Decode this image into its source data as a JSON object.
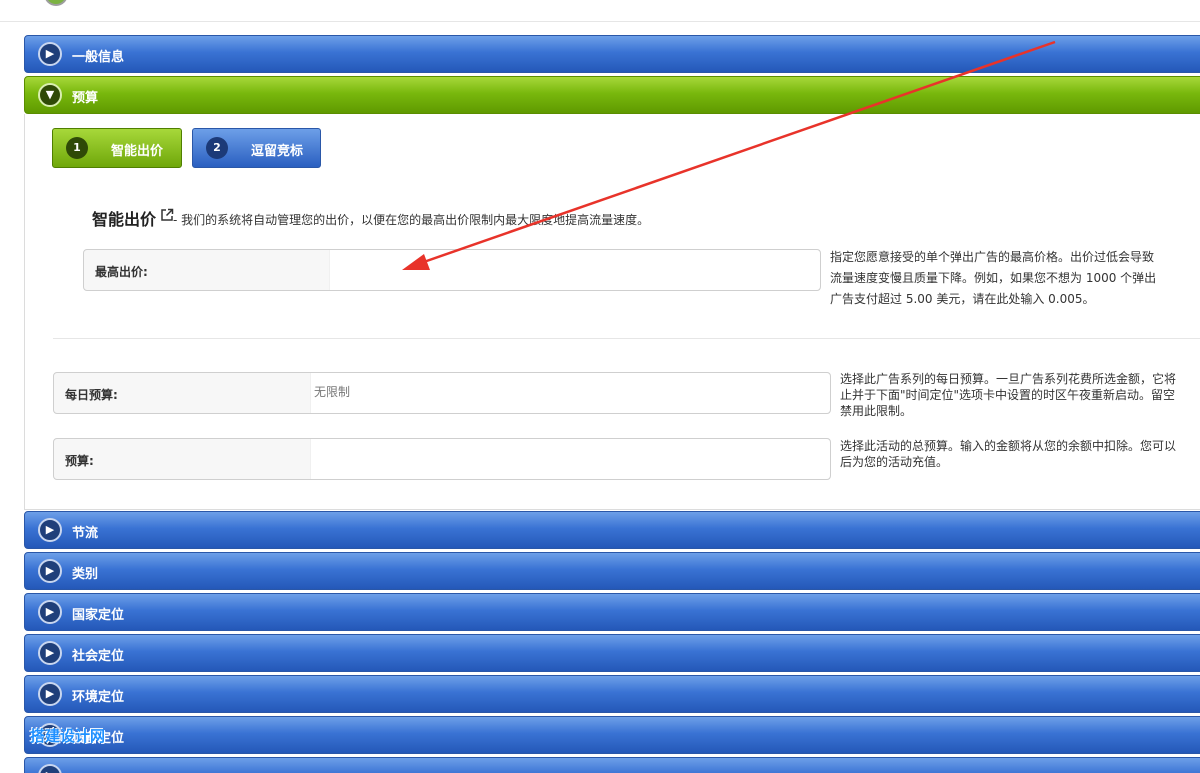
{
  "sections": {
    "general_info": "一般信息",
    "budget": "预算",
    "throttle": "节流",
    "category": "类别",
    "country_targeting": "国家定位",
    "social_targeting": "社会定位",
    "environment_targeting": "环境定位",
    "device_targeting": "设备定位"
  },
  "steps": [
    {
      "num": "1",
      "label": "智能出价"
    },
    {
      "num": "2",
      "label": "逗留竞标"
    }
  ],
  "smart_bid": {
    "heading": "智能出价",
    "description": "- 我们的系统将自动管理您的出价，以便在您的最高出价限制内最大限度地提高流量速度。"
  },
  "max_bid": {
    "label": "最高出价:",
    "value": "",
    "help": [
      "指定您愿意接受的单个弹出广告的最高价格。出价过低会导致",
      "流量速度变慢且质量下降。例如，如果您不想为 1000 个弹出",
      "广告支付超过 5.00 美元，请在此处输入 0.005。"
    ]
  },
  "daily_budget": {
    "label": "每日预算:",
    "placeholder": "无限制",
    "help": [
      "选择此广告系列的每日预算。一旦广告系列花费所选金额，它将",
      "止并于下面\"时间定位\"选项卡中设置的时区午夜重新启动。留空",
      "禁用此限制。"
    ]
  },
  "total_budget": {
    "label": "预算:",
    "value": "",
    "help": [
      "选择此活动的总预算。输入的金额将从您的余额中扣除。您可以",
      "后为您的活动充值。"
    ]
  },
  "colors": {
    "blue_header": "#3a73d4",
    "green_header": "#79b80d",
    "annotation_arrow": "#e8332a"
  },
  "watermark": "搭建设计网"
}
